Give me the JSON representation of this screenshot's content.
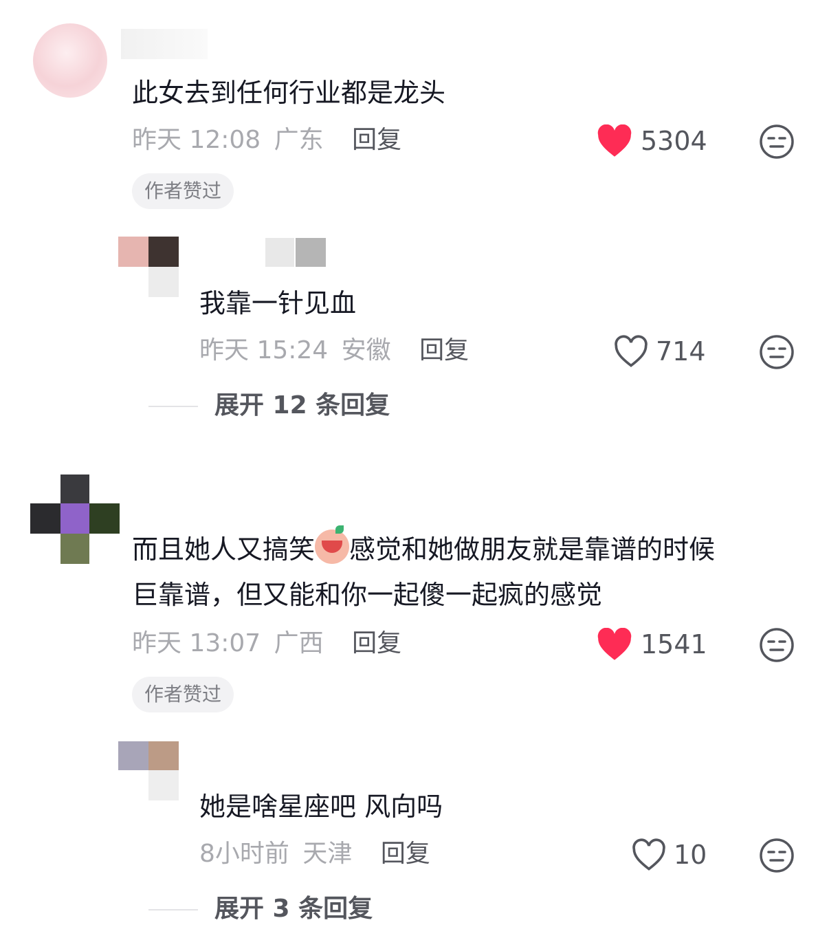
{
  "comments": [
    {
      "text": "此女去到任何行业都是龙头",
      "time": "昨天 12:08",
      "location": "广东",
      "reply_label": "回复",
      "likes": "5304",
      "liked": true,
      "badge": "作者赞过",
      "replies": [
        {
          "text": "我靠一针见血",
          "time": "昨天 15:24",
          "location": "安徽",
          "reply_label": "回复",
          "likes": "714",
          "liked": false
        }
      ],
      "expand_label": "展开 12 条回复"
    },
    {
      "text_line1_a": "而且她人又搞笑",
      "text_line1_b": "感觉和她做朋友就是靠谱的时候",
      "text_line2": "巨靠谱，但又能和你一起傻一起疯的感觉",
      "time": "昨天 13:07",
      "location": "广西",
      "reply_label": "回复",
      "likes": "1541",
      "liked": true,
      "badge": "作者赞过",
      "replies": [
        {
          "text": "她是啥星座吧 风向吗",
          "time": "8小时前",
          "location": "天津",
          "reply_label": "回复",
          "likes": "10",
          "liked": false
        }
      ],
      "expand_label": "展开 3 条回复"
    }
  ],
  "colors": {
    "like_active": "#fe2c55",
    "meta": "#a8a9ae",
    "action": "#54565d"
  },
  "icons": {
    "liked": "heart-filled-icon",
    "unliked": "heart-outline-icon",
    "dislike": "meh-face-icon",
    "emoji": "crying-laugh-emoji"
  }
}
